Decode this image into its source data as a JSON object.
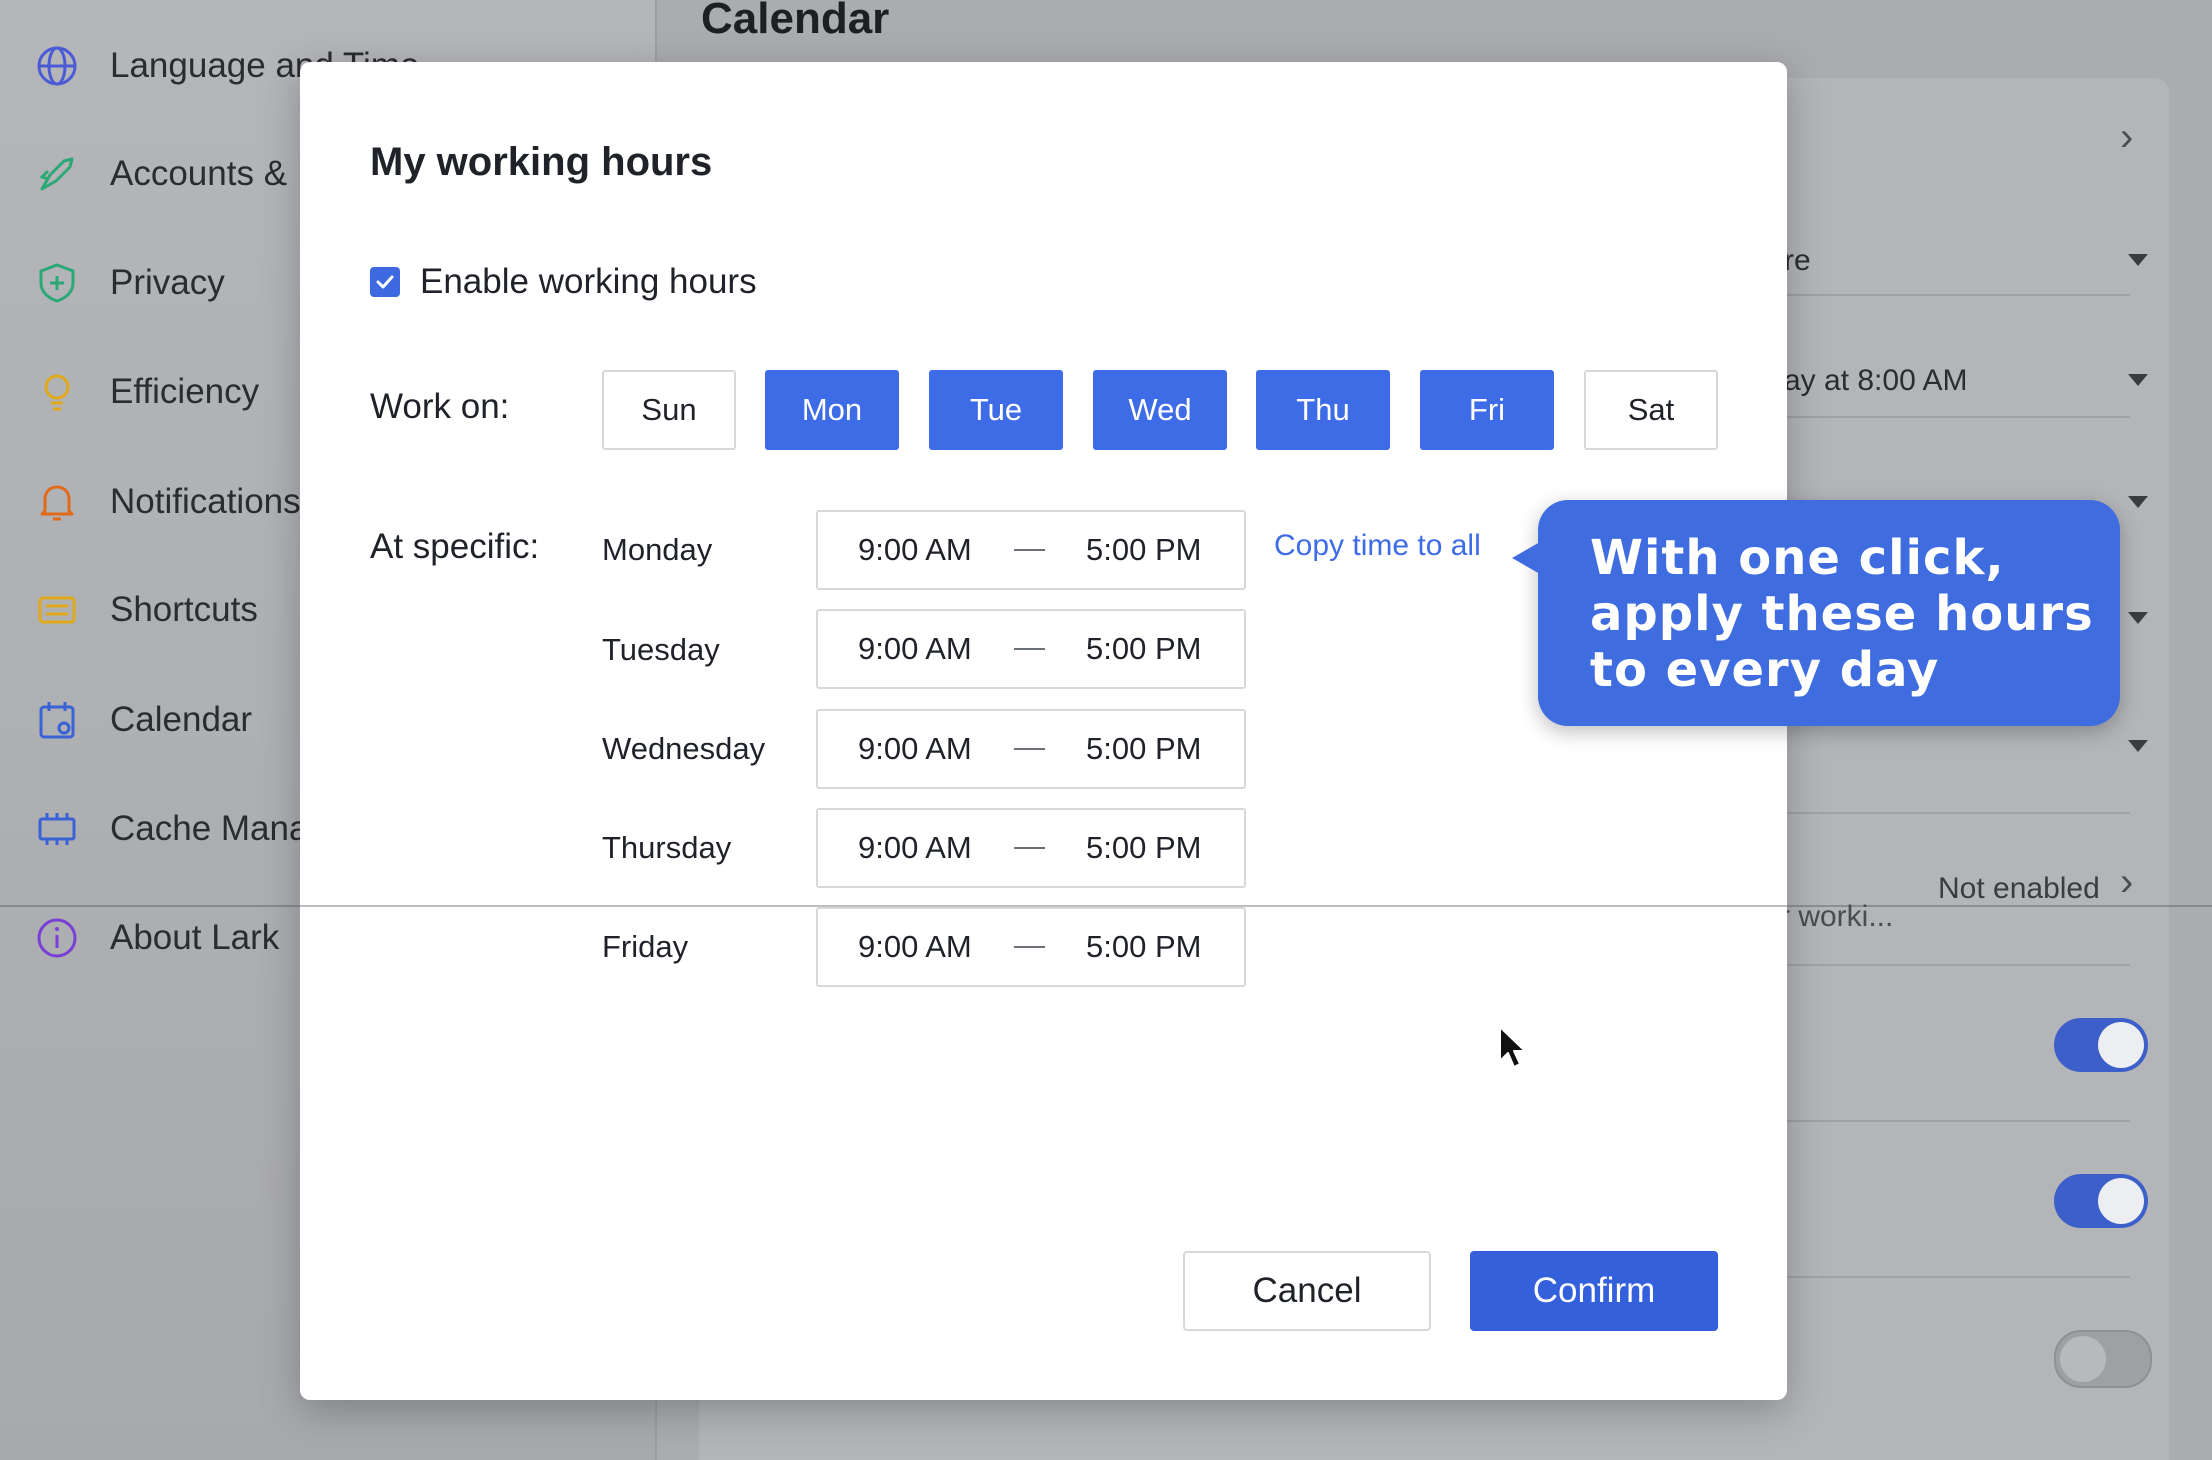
{
  "sidebar": {
    "items": [
      {
        "label": "Language and Time",
        "icon": "globe-icon",
        "color": "#4b5bd6"
      },
      {
        "label": "Accounts &",
        "icon": "rocket-icon",
        "color": "#2aa876"
      },
      {
        "label": "Privacy",
        "icon": "shield-icon",
        "color": "#2aa876"
      },
      {
        "label": "Efficiency",
        "icon": "lightbulb-icon",
        "color": "#e0a91a"
      },
      {
        "label": "Notifications",
        "icon": "bell-icon",
        "color": "#e06a1a"
      },
      {
        "label": "Shortcuts",
        "icon": "keyboard-icon",
        "color": "#e0a91a"
      },
      {
        "label": "Calendar",
        "icon": "calendar-icon",
        "color": "#3a62d6"
      },
      {
        "label": "Cache Mana",
        "icon": "chip-icon",
        "color": "#3a62d6"
      },
      {
        "label": "About Lark",
        "icon": "info-icon",
        "color": "#7a3fd6"
      }
    ]
  },
  "main": {
    "heading": "Calendar",
    "rows": {
      "row2": "re",
      "row3": "ay at 8:00 AM",
      "not_enabled": "Not enabled",
      "working_note": "r worki..."
    }
  },
  "modal": {
    "title": "My working hours",
    "enable_label": "Enable working hours",
    "enable_checked": true,
    "work_on_label": "Work on:",
    "days": [
      {
        "label": "Sun",
        "selected": false
      },
      {
        "label": "Mon",
        "selected": true
      },
      {
        "label": "Tue",
        "selected": true
      },
      {
        "label": "Wed",
        "selected": true
      },
      {
        "label": "Thu",
        "selected": true
      },
      {
        "label": "Fri",
        "selected": true
      },
      {
        "label": "Sat",
        "selected": false
      }
    ],
    "at_specific_label": "At specific:",
    "schedule": [
      {
        "day": "Monday",
        "start": "9:00 AM",
        "end": "5:00 PM"
      },
      {
        "day": "Tuesday",
        "start": "9:00 AM",
        "end": "5:00 PM"
      },
      {
        "day": "Wednesday",
        "start": "9:00 AM",
        "end": "5:00 PM"
      },
      {
        "day": "Thursday",
        "start": "9:00 AM",
        "end": "5:00 PM"
      },
      {
        "day": "Friday",
        "start": "9:00 AM",
        "end": "5:00 PM"
      }
    ],
    "range_separator": "—",
    "copy_link": "Copy time to all",
    "cancel_label": "Cancel",
    "confirm_label": "Confirm"
  },
  "callout": {
    "text": "With one click, apply these hours to every day"
  },
  "colors": {
    "accent": "#3e6ce6",
    "confirm": "#3560db",
    "callout": "#3f6de0"
  }
}
